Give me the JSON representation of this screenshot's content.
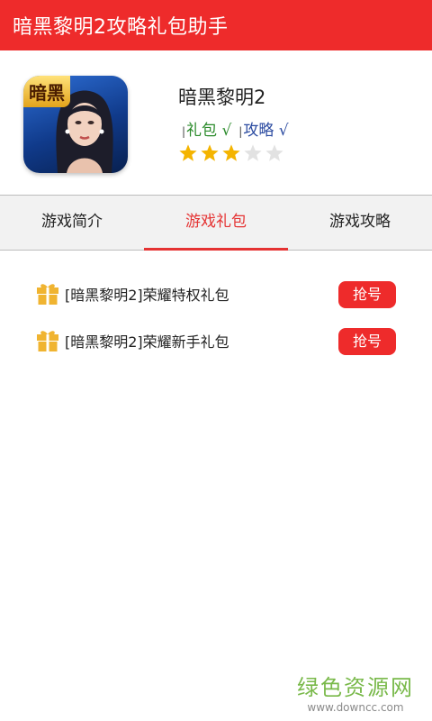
{
  "app": {
    "title": "暗黑黎明2攻略礼包助手"
  },
  "game": {
    "name": "暗黑黎明2",
    "icon_logo_text": "暗黑",
    "tags": [
      {
        "label": "礼包 √",
        "color": "#2a8a2a"
      },
      {
        "label": "攻略 √",
        "color": "#2a4aa0"
      }
    ],
    "tag_separator": "|",
    "rating": 3,
    "rating_max": 5
  },
  "tabs": [
    {
      "label": "游戏简介",
      "active": false
    },
    {
      "label": "游戏礼包",
      "active": true
    },
    {
      "label": "游戏攻略",
      "active": false
    }
  ],
  "gifts": [
    {
      "label": "[暗黑黎明2]荣耀特权礼包",
      "button": "抢号",
      "icon": "gift-icon"
    },
    {
      "label": "[暗黑黎明2]荣耀新手礼包",
      "button": "抢号",
      "icon": "gift-icon"
    }
  ],
  "watermark": {
    "cn": "绿色资源网",
    "en": "www.downcc.com"
  },
  "colors": {
    "accent": "#ee2b2b",
    "star_filled": "#f4b400",
    "star_empty": "#e2e2e2",
    "gift_icon": "#f0b431"
  }
}
